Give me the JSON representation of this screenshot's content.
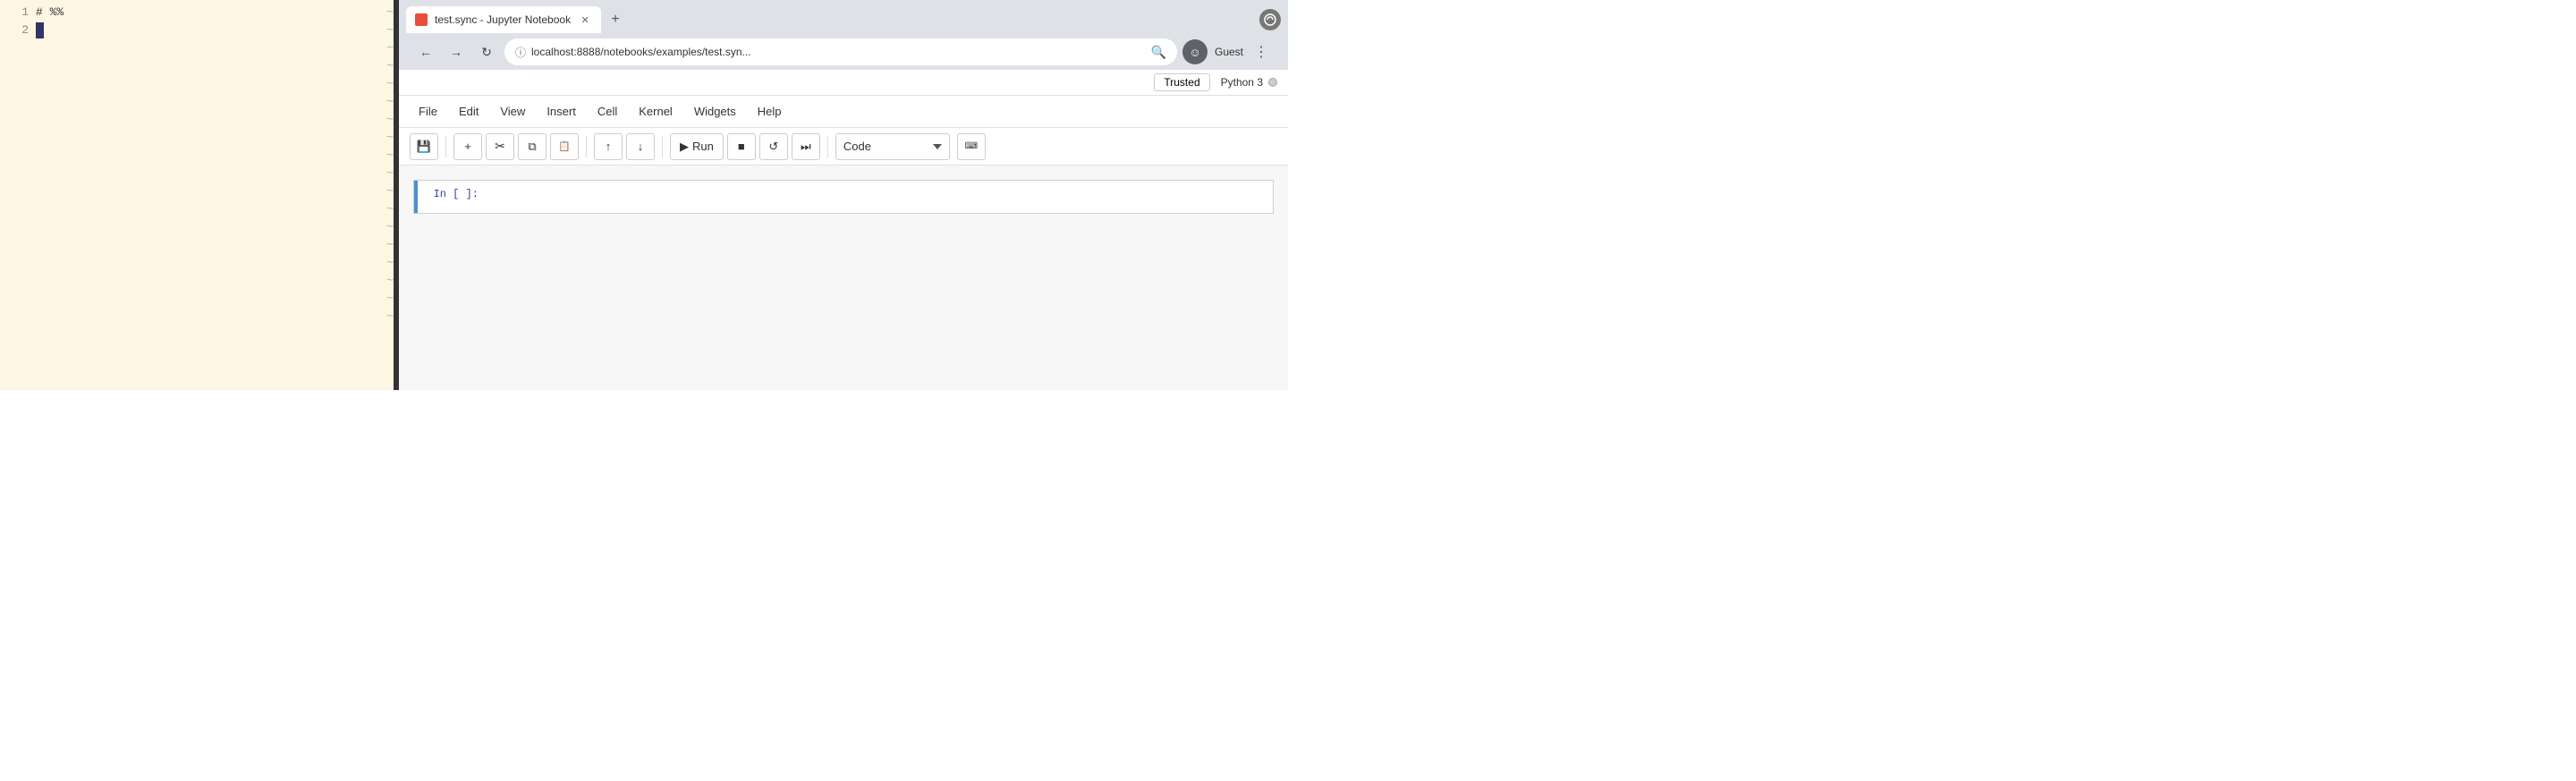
{
  "editor": {
    "background": "#fdf6e3",
    "line1": "# %%",
    "line2_cursor": true,
    "tilde_count": 18,
    "tilde_char": "~"
  },
  "browser": {
    "tab": {
      "title": "test.sync - Jupyter Notebook",
      "favicon_color": "#e74c3c"
    },
    "address": "localhost:8888/notebooks/examples/test.syn...",
    "user_label": "Guest",
    "nav": {
      "back_label": "←",
      "forward_label": "→",
      "refresh_label": "↻"
    }
  },
  "jupyter": {
    "trusted_label": "Trusted",
    "kernel_label": "Python 3",
    "menu": {
      "items": [
        "File",
        "Edit",
        "View",
        "Insert",
        "Cell",
        "Kernel",
        "Widgets",
        "Help"
      ]
    },
    "toolbar": {
      "save_icon": "💾",
      "add_icon": "+",
      "cut_icon": "✂",
      "copy_icon": "⧉",
      "paste_icon": "📋",
      "move_up_icon": "↑",
      "move_down_icon": "↓",
      "run_label": "Run",
      "stop_icon": "■",
      "restart_icon": "↺",
      "fast_forward_icon": "⏭",
      "cell_type": "Code",
      "keyboard_icon": "⌨"
    },
    "cell": {
      "prompt": "In [ ]:",
      "content": ""
    }
  }
}
